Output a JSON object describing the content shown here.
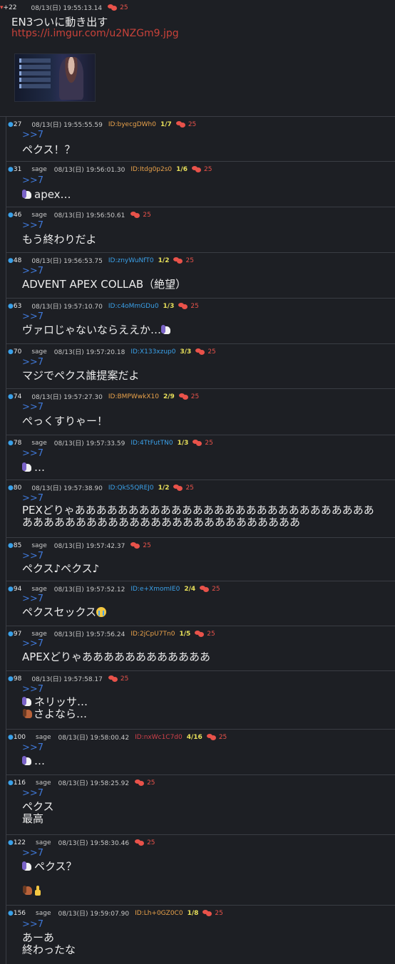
{
  "op": {
    "num": "+22",
    "date": "08/13(日) 19:55:13.14",
    "replies": "25",
    "title": "EN3ついに動き出す",
    "link": "https://i.imgur.com/u2NZGm9.jpg"
  },
  "posts": [
    {
      "num": "27",
      "sage": "",
      "date": "08/13(日) 19:55:55.59",
      "id": "ID:byecgDWh0",
      "count": "1/7",
      "replies": "25",
      "anchor": ">>7",
      "lines": [
        "ペクス！？"
      ]
    },
    {
      "num": "31",
      "sage": "sage",
      "date": "08/13(日) 19:56:01.30",
      "id": "ID:Itdg0p2s0",
      "count": "1/6",
      "replies": "25",
      "anchor": ">>7",
      "lines": [
        "apex…"
      ]
    },
    {
      "num": "46",
      "sage": "sage",
      "date": "08/13(日) 19:56:50.61",
      "id": "",
      "count": "",
      "replies": "25",
      "anchor": ">>7",
      "lines": [
        "もう終わりだよ"
      ]
    },
    {
      "num": "48",
      "sage": "",
      "date": "08/13(日) 19:56:53.75",
      "id": "ID:znyWuNfT0",
      "count": "1/2",
      "replies": "25",
      "anchor": ">>7",
      "lines": [
        "ADVENT APEX COLLAB（絶望）"
      ]
    },
    {
      "num": "63",
      "sage": "",
      "date": "08/13(日) 19:57:10.70",
      "id": "ID:c4oMmGDu0",
      "count": "1/3",
      "replies": "25",
      "anchor": ">>7",
      "lines": [
        "ヴァロじゃないならええか…"
      ]
    },
    {
      "num": "70",
      "sage": "sage",
      "date": "08/13(日) 19:57:20.18",
      "id": "ID:X133xzup0",
      "count": "3/3",
      "replies": "25",
      "anchor": ">>7",
      "lines": [
        "マジでペクス誰提案だよ"
      ]
    },
    {
      "num": "74",
      "sage": "",
      "date": "08/13(日) 19:57:27.30",
      "id": "ID:BMPWwkX10",
      "count": "2/9",
      "replies": "25",
      "anchor": ">>7",
      "lines": [
        "ぺっくすりゃー！"
      ]
    },
    {
      "num": "78",
      "sage": "sage",
      "date": "08/13(日) 19:57:33.59",
      "id": "ID:4TtFutTN0",
      "count": "1/3",
      "replies": "25",
      "anchor": ">>7",
      "lines": [
        "…"
      ]
    },
    {
      "num": "80",
      "sage": "",
      "date": "08/13(日) 19:57:38.90",
      "id": "ID:QkS5QREJ0",
      "count": "1/2",
      "replies": "25",
      "anchor": ">>7",
      "lines": [
        "PEXどりゃああああああああああああああああああああああああああああ",
        "ああああああああああああああああああああああああああ"
      ]
    },
    {
      "num": "85",
      "sage": "sage",
      "date": "08/13(日) 19:57:42.37",
      "id": "",
      "count": "",
      "replies": "25",
      "anchor": ">>7",
      "lines": [
        "ペクス♪ペクス♪"
      ]
    },
    {
      "num": "94",
      "sage": "sage",
      "date": "08/13(日) 19:57:52.12",
      "id": "ID:e+XmomIE0",
      "count": "2/4",
      "replies": "25",
      "anchor": ">>7",
      "lines": [
        "ペクスセックス"
      ]
    },
    {
      "num": "97",
      "sage": "sage",
      "date": "08/13(日) 19:57:56.24",
      "id": "ID:2jCpU7Tn0",
      "count": "1/5",
      "replies": "25",
      "anchor": ">>7",
      "lines": [
        "APEXどりゃああああああああああああ"
      ]
    },
    {
      "num": "98",
      "sage": "",
      "date": "08/13(日) 19:57:58.17",
      "id": "",
      "count": "",
      "replies": "25",
      "anchor": ">>7",
      "lines": [
        "ネリッサ…",
        "さよなら…"
      ]
    },
    {
      "num": "100",
      "sage": "sage",
      "date": "08/13(日) 19:58:00.42",
      "id": "ID:nxWc1C7d0",
      "count": "4/16",
      "replies": "25",
      "anchor": ">>7",
      "lines": [
        "…"
      ]
    },
    {
      "num": "116",
      "sage": "sage",
      "date": "08/13(日) 19:58:25.92",
      "id": "",
      "count": "",
      "replies": "25",
      "anchor": ">>7",
      "lines": [
        "ペクス",
        "最高"
      ]
    },
    {
      "num": "122",
      "sage": "sage",
      "date": "08/13(日) 19:58:30.46",
      "id": "",
      "count": "",
      "replies": "25",
      "anchor": ">>7",
      "lines": [
        "ペクス？",
        ""
      ]
    },
    {
      "num": "156",
      "sage": "sage",
      "date": "08/13(日) 19:59:07.90",
      "id": "ID:Lh+0GZ0C0",
      "count": "1/8",
      "replies": "25",
      "anchor": ">>7",
      "lines": [
        "あーあ",
        "終わったな"
      ]
    }
  ],
  "colors": {
    "background": "#1d1f24",
    "anchor": "#3f78d8",
    "link": "#c8423a",
    "reply_icon": "#e8524a",
    "count": "#e8e05a",
    "id_orange": "#e8a14a",
    "id_blue": "#3aa0e8",
    "id_red": "#d0404a"
  },
  "icons": {
    "unicorn": "unicorn-icon",
    "horse": "horse-icon",
    "crying": "crying-face-icon",
    "middle_finger": "middle-finger-icon",
    "replies": "speech-bubbles-icon"
  }
}
